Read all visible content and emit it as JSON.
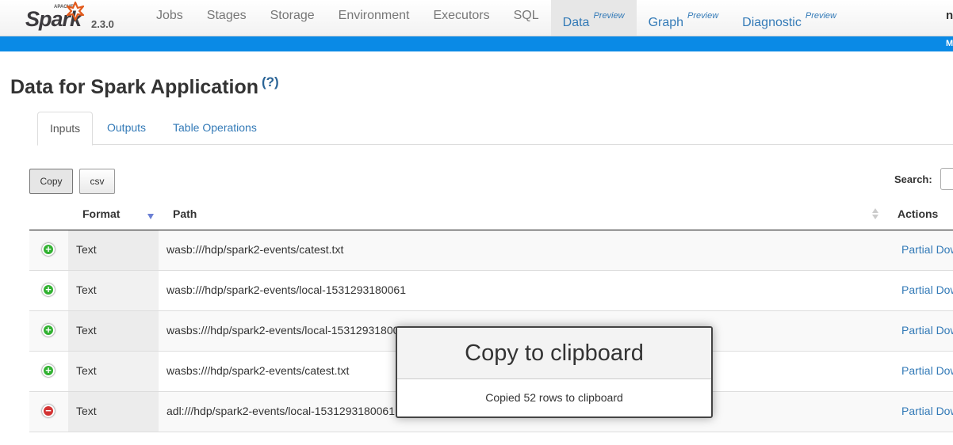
{
  "brand": {
    "apache": "APACHE",
    "name": "Spark",
    "version": "2.3.0"
  },
  "nav": {
    "items": [
      {
        "label": "Jobs"
      },
      {
        "label": "Stages"
      },
      {
        "label": "Storage"
      },
      {
        "label": "Environment"
      },
      {
        "label": "Executors"
      },
      {
        "label": "SQL"
      },
      {
        "label": "Data",
        "tag": "Preview"
      },
      {
        "label": "Graph",
        "tag": "Preview"
      },
      {
        "label": "Diagnostic",
        "tag": "Preview"
      }
    ],
    "active": "Data",
    "right_text": "n",
    "bar_text": "M"
  },
  "page": {
    "title": "Data for Spark Application",
    "help": "(?)"
  },
  "tabs": [
    "Inputs",
    "Outputs",
    "Table Operations"
  ],
  "buttons": {
    "copy": "Copy",
    "csv": "csv"
  },
  "search": {
    "label": "Search:"
  },
  "table": {
    "headers": {
      "format": "Format",
      "path": "Path",
      "actions": "Actions"
    },
    "rows": [
      {
        "format": "Text",
        "path": "wasb:///hdp/spark2-events/catest.txt",
        "action": "Partial Dow",
        "expand": "+"
      },
      {
        "format": "Text",
        "path": "wasb:///hdp/spark2-events/local-1531293180061",
        "action": "Partial Dow",
        "expand": "+"
      },
      {
        "format": "Text",
        "path": "wasbs:///hdp/spark2-events/local-15312931800",
        "action": "Partial Dow",
        "expand": "+"
      },
      {
        "format": "Text",
        "path": "wasbs:///hdp/spark2-events/catest.txt",
        "action": "Partial Dow",
        "expand": "+"
      },
      {
        "format": "Text",
        "path": "adl:///hdp/spark2-events/local-1531293180061",
        "action": "Partial Dow",
        "expand": "−"
      }
    ]
  },
  "dialog": {
    "title": "Copy to clipboard",
    "message": "Copied 52 rows to clipboard"
  },
  "colors": {
    "accent": "#337ab7",
    "bluebar": "#0a8ae6",
    "logo_orange": "#e25a1c",
    "expand_green": "#31b131",
    "collapse_red": "#d33333"
  }
}
